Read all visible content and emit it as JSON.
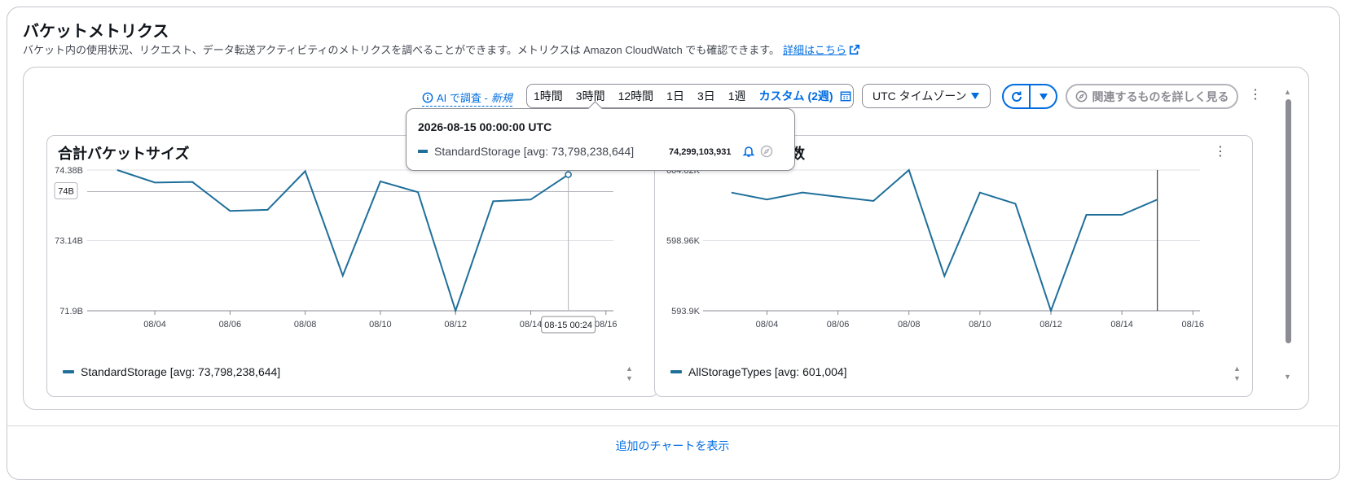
{
  "header": {
    "title": "バケットメトリクス",
    "description": "バケット内の使用状況、リクエスト、データ転送アクティビティのメトリクスを調べることができます。メトリクスは Amazon CloudWatch でも確認できます。",
    "details_link": "詳細はこちら"
  },
  "toolbar": {
    "ai_prefix": "AI で調査 -",
    "ai_new": "新規",
    "ranges": [
      "1時間",
      "3時間",
      "12時間",
      "1日",
      "3日",
      "1週"
    ],
    "custom_range": "カスタム (2週)",
    "timezone": "UTC タイムゾーン",
    "related_button": "関連するものを詳しく見る"
  },
  "tooltip": {
    "datetime": "2026-08-15 00:00:00 UTC",
    "series_label": "StandardStorage [avg: 73,798,238,644]",
    "value": "74,299,103,931"
  },
  "footer": {
    "show_more": "追加のチャートを表示"
  },
  "chart_data": [
    {
      "type": "line",
      "title": "合計バケットサイズ",
      "y_tick_labels": [
        "74.38B",
        "73.14B",
        "71.9B"
      ],
      "y_ticks": [
        74.38,
        73.14,
        71.9
      ],
      "ylim": [
        71.9,
        74.38
      ],
      "threshold_label": "74B",
      "threshold_value": 74.0,
      "x_tick_labels": [
        "08/04",
        "08/06",
        "08/08",
        "08/10",
        "08/12",
        "08/14",
        "08/16"
      ],
      "x_ticks": [
        4,
        6,
        8,
        10,
        12,
        14,
        16
      ],
      "xlim": [
        2.2,
        16.2
      ],
      "cursor_x": 15,
      "cursor_label": "08-15 00:24",
      "series": [
        {
          "name": "StandardStorage [avg: 73,798,238,644]",
          "color": "#1f6f9a",
          "x": [
            3,
            4,
            5,
            6,
            7,
            8,
            9,
            10,
            11,
            12,
            13,
            14,
            15
          ],
          "y": [
            74.38,
            74.16,
            74.17,
            73.66,
            73.68,
            74.36,
            72.52,
            74.18,
            73.99,
            71.9,
            73.83,
            73.86,
            74.3
          ]
        }
      ]
    },
    {
      "type": "line",
      "title": "計数",
      "y_tick_labels": [
        "604.02K",
        "598.96K",
        "593.9K"
      ],
      "y_ticks": [
        604.02,
        598.96,
        593.9
      ],
      "ylim": [
        593.9,
        604.02
      ],
      "x_tick_labels": [
        "08/04",
        "08/06",
        "08/08",
        "08/10",
        "08/12",
        "08/14",
        "08/16"
      ],
      "x_ticks": [
        4,
        6,
        8,
        10,
        12,
        14,
        16
      ],
      "xlim": [
        2.2,
        16.2
      ],
      "cursor_x": 15,
      "series": [
        {
          "name": "AllStorageTypes [avg: 601,004]",
          "color": "#1f6f9a",
          "x": [
            3,
            4,
            5,
            6,
            7,
            8,
            9,
            10,
            11,
            12,
            13,
            14,
            15
          ],
          "y": [
            602.4,
            601.9,
            602.4,
            602.1,
            601.8,
            604.02,
            596.4,
            602.4,
            601.6,
            593.9,
            600.8,
            600.8,
            601.9
          ]
        }
      ]
    }
  ]
}
